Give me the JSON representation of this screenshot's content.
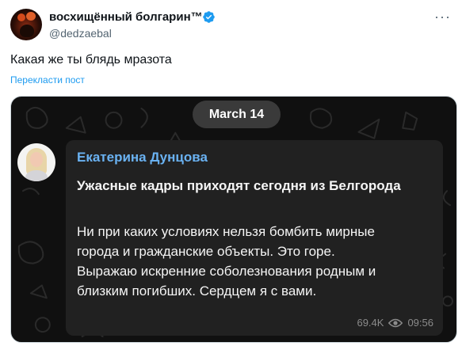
{
  "tweet": {
    "display_name": "восхищённый болгарин™",
    "handle": "@dedzaebal",
    "text": "Какая же ты блядь мразота",
    "translate_label": "Перекласти пост",
    "more_icon": "more-horizontal-icon",
    "verified_icon": "verified-badge-icon",
    "verified_color": "#1d9bf0"
  },
  "media": {
    "date_label": "March 14",
    "message": {
      "author": "Екатерина Дунцова",
      "headline": "Ужасные кадры приходят сегодня из Белгорода",
      "body_lines": [
        "Ни при каких условиях нельзя бомбить мирные",
        "города и гражданские объекты. Это горе.",
        "Выражаю искренние соболезнования родным и",
        "близким погибших. Сердцем я с вами."
      ],
      "views": "69.4K",
      "time": "09:56",
      "views_icon": "eye-icon",
      "author_color": "#6ab2f2"
    }
  }
}
